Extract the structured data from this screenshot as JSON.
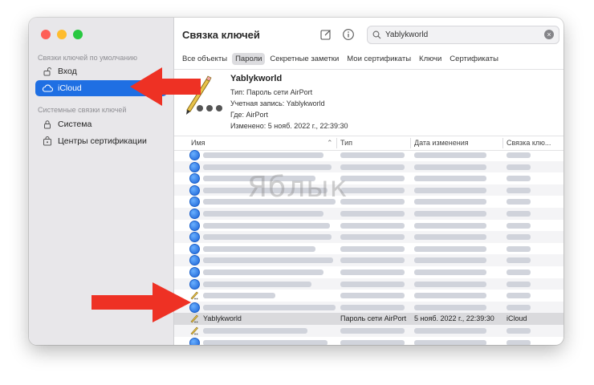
{
  "window": {
    "title": "Связка ключей"
  },
  "search": {
    "value": "Yablykworld"
  },
  "sidebar": {
    "section_default": "Связки ключей по умолчанию",
    "section_system": "Системные связки ключей",
    "items": [
      {
        "label": "Вход",
        "icon": "lock-open-icon"
      },
      {
        "label": "iCloud",
        "icon": "cloud-icon",
        "selected": true
      },
      {
        "label": "Система",
        "icon": "lock-icon"
      },
      {
        "label": "Центры сертификации",
        "icon": "certificate-icon"
      }
    ]
  },
  "tabs": [
    "Все объекты",
    "Пароли",
    "Секретные заметки",
    "Мои сертификаты",
    "Ключи",
    "Сертификаты"
  ],
  "selected_tab": "Пароли",
  "detail": {
    "name": "Yablykworld",
    "type": "Тип:  Пароль сети AirPort",
    "account": "Учетная запись:  Yablykworld",
    "where": "Где:  AirPort",
    "modified": "Изменено:  5 нояб. 2022 г., 22:39:30"
  },
  "columns": {
    "name": "Имя",
    "type": "Тип",
    "date": "Дата изменения",
    "keychain": "Связка клю..."
  },
  "selected_row": {
    "name": "Yablykworld",
    "type": "Пароль сети AirPort",
    "date": "5 нояб. 2022 г., 22:39:30",
    "keychain": "iCloud"
  },
  "watermark": "Яблык",
  "colors": {
    "accent": "#1f6fe3",
    "arrow": "#ee3124"
  }
}
